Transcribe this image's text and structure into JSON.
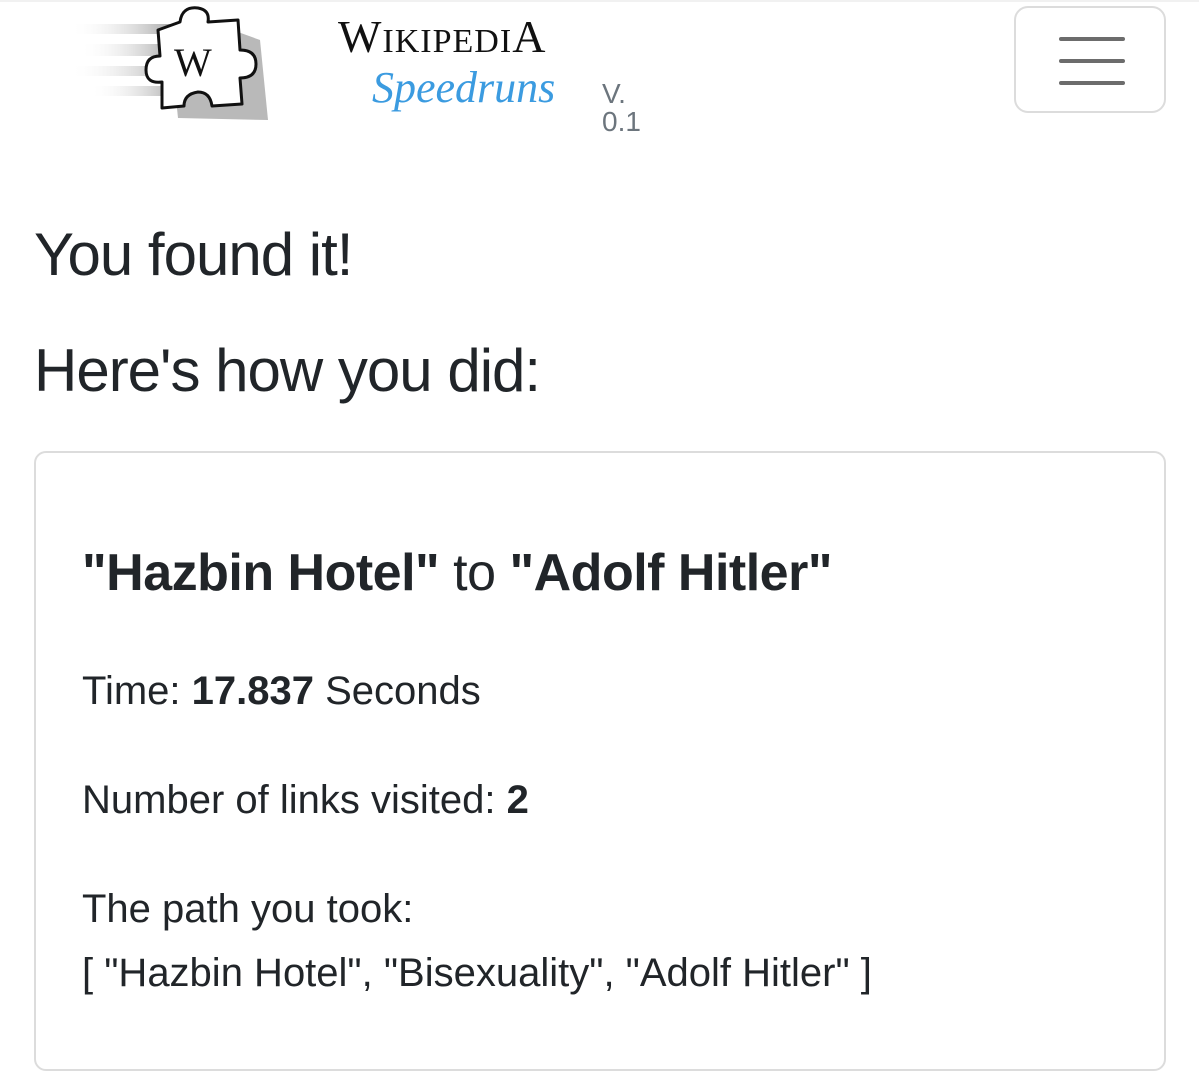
{
  "header": {
    "brand_title_lead": "W",
    "brand_title_rest": "IKIPEDI",
    "brand_title_tail": "A",
    "brand_subtitle": "Speedruns",
    "version": "V. 0.1",
    "logo_glyph": "W",
    "menu_icon": "hamburger-icon"
  },
  "main": {
    "heading": "You found it!",
    "subheading": "Here's how you did:"
  },
  "result": {
    "start": "\"Hazbin Hotel\"",
    "connector": " to ",
    "target": "\"Adolf Hitler\"",
    "time_label": "Time: ",
    "time_value": "17.837",
    "time_unit": " Seconds",
    "links_label": "Number of links visited: ",
    "links_value": "2",
    "path_label": "The path you took:",
    "path": "[ \"Hazbin Hotel\", \"Bisexuality\", \"Adolf Hitler\" ]"
  },
  "colors": {
    "accent": "#3b9be0",
    "text": "#212529",
    "muted": "#6c757d",
    "border": "#dcdcdc"
  }
}
